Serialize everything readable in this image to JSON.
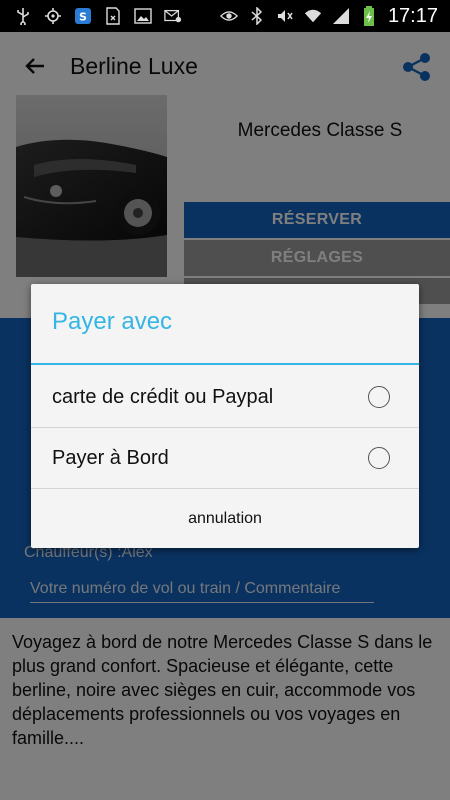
{
  "status_bar": {
    "time": "17:17",
    "icons": [
      "usb-icon",
      "gps-icon",
      "shazam-icon",
      "sim-icon",
      "image-icon",
      "mail-icon",
      "eye-icon",
      "bluetooth-icon",
      "mute-icon",
      "wifi-icon",
      "signal-icon",
      "battery-charging-icon"
    ]
  },
  "app_bar": {
    "title": "Berline Luxe",
    "back_icon": "arrow-back-icon",
    "share_icon": "share-icon"
  },
  "car": {
    "name": "Mercedes Classe S",
    "image": "black-mercedes-photo"
  },
  "buttons": {
    "reserve": "RÉSERVER",
    "settings": "RÉGLAGES"
  },
  "details": {
    "chauffeur": "Chauffeur(s) :Alex",
    "comment_placeholder": "Votre numéro de vol ou train / Commentaire"
  },
  "description": "Voyagez à bord de notre Mercedes Classe S dans le plus grand confort. Spacieuse et élégante, cette berline, noire avec sièges en cuir, accommode vos déplacements professionnels ou vos voyages en famille....",
  "dialog": {
    "title": "Payer avec",
    "options": [
      {
        "label": "carte de crédit ou Paypal",
        "selected": false
      },
      {
        "label": "Payer à Bord",
        "selected": false
      }
    ],
    "cancel": "annulation"
  },
  "colors": {
    "primary_blue": "#1565c0",
    "accent": "#33b5e5",
    "grey_button": "#9e9e9e"
  }
}
